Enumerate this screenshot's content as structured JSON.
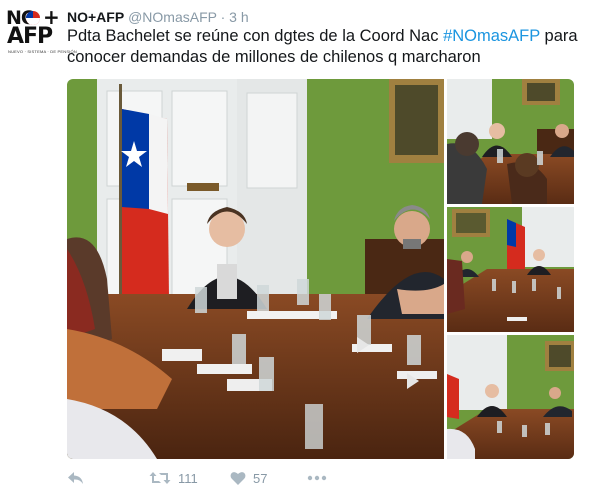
{
  "account": {
    "avatar_logo_top": "NO",
    "avatar_logo_plus": "+",
    "avatar_logo_bottom": "AFP",
    "avatar_logo_tagline": "NUEVO · SISTEMA · DE PENSIÓN",
    "display_name": "NO+AFP",
    "handle": "@NOmasAFP",
    "separator": "·",
    "timestamp": "3 h"
  },
  "tweet": {
    "text_before": "Pdta Bachelet se reúne con dgtes de la Coord Nac ",
    "hashtag": "#NOmasAFP",
    "text_after": " para conocer demandas de millones de chilenos q marcharon"
  },
  "media": {
    "photo_count": 4,
    "icons": [
      "photo-main",
      "photo-2",
      "photo-3",
      "photo-4"
    ]
  },
  "actions": {
    "reply_icon": "reply-icon",
    "retweet_icon": "retweet-icon",
    "retweet_count": "111",
    "like_icon": "heart-icon",
    "like_count": "57",
    "more_icon": "more-icon"
  },
  "colors": {
    "hashtag": "#1b95e0",
    "muted": "#8899a6",
    "icon": "#aab8c2",
    "wall_green": "#6e9a3c",
    "table_wood": "#6b3a1f"
  }
}
